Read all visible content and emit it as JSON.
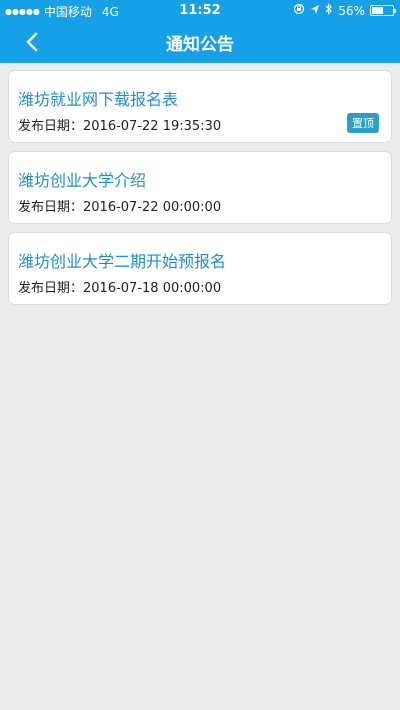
{
  "status_bar": {
    "signal_dots": "●●●●●",
    "carrier": "中国移动",
    "network": "4G",
    "time": "11:52",
    "battery_label": "56%",
    "battery_level": 0.56
  },
  "nav": {
    "title": "通知公告"
  },
  "notices": [
    {
      "title": "潍坊就业网下载报名表",
      "date_label": "发布日期：",
      "date": "2016-07-22 19:35:30",
      "badge": "置顶"
    },
    {
      "title": "潍坊创业大学介绍",
      "date_label": "发布日期：",
      "date": "2016-07-22 00:00:00"
    },
    {
      "title": "潍坊创业大学二期开始预报名",
      "date_label": "发布日期：",
      "date": "2016-07-18 00:00:00"
    }
  ],
  "colors": {
    "header": "#15a0e8",
    "title_text": "#1f8fcf",
    "badge": "#2aa0c8",
    "background": "#ececec"
  }
}
